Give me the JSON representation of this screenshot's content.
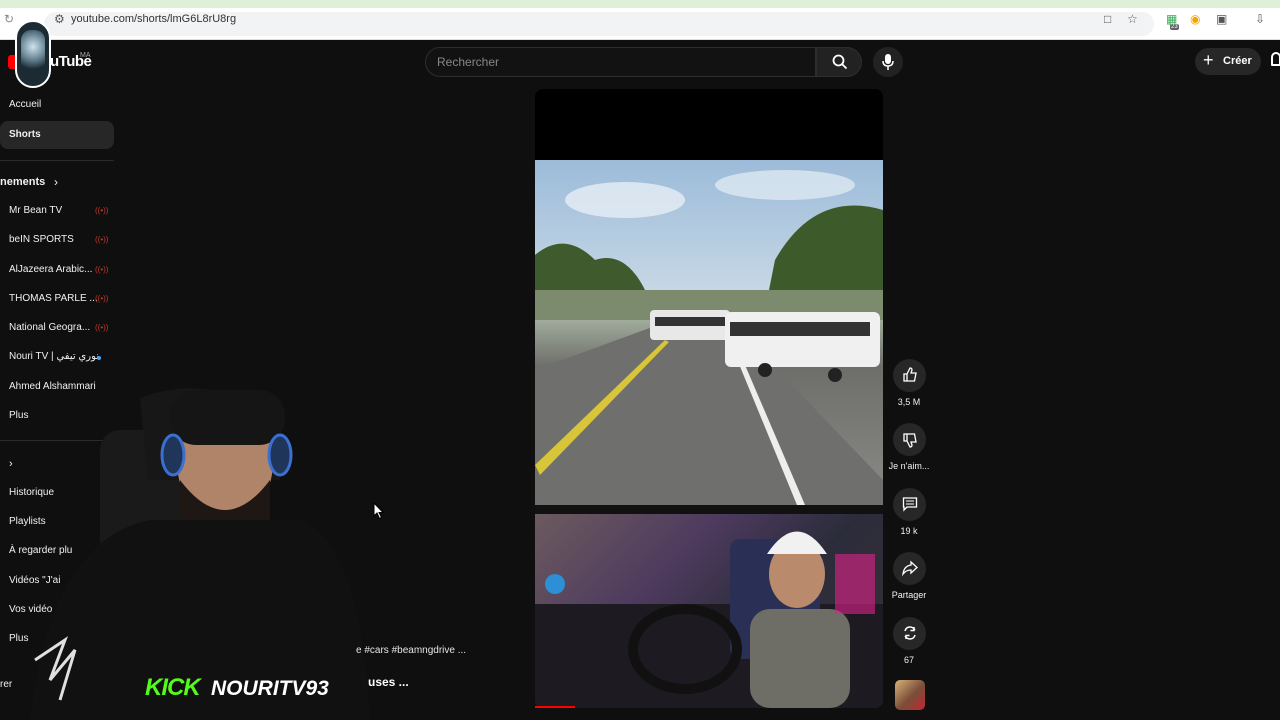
{
  "browser": {
    "url": "youtube.com/shorts/lmG6L8rU8rg",
    "extension_badge": "23"
  },
  "header": {
    "logo_text": "uTube",
    "country_code": "MA",
    "search_placeholder": "Rechercher",
    "create_label": "Créer"
  },
  "sidebar": {
    "home": "Accueil",
    "shorts": "Shorts",
    "subscriptions_heading": "nements",
    "subscriptions": [
      {
        "label": "Mr Bean TV",
        "indicator": "live"
      },
      {
        "label": "beIN SPORTS",
        "indicator": "live"
      },
      {
        "label": "AlJazeera Arabic...",
        "indicator": "live"
      },
      {
        "label": "THOMAS PARLE ...",
        "indicator": "live"
      },
      {
        "label": "National Geogra...",
        "indicator": "live"
      },
      {
        "label": "Nouri TV | نوري تيفي",
        "indicator": "new"
      },
      {
        "label": "Ahmed Alshammari",
        "indicator": ""
      }
    ],
    "more_label": "Plus",
    "you_items": [
      "Historique",
      "Playlists",
      "À regarder plu",
      "Vidéos \"J'ai",
      "Vos vidéo",
      "Plus"
    ],
    "explore_fragment": "rer"
  },
  "short": {
    "hashtags": "e #cars #beamngdrive ...",
    "title_fragment": "uses ..."
  },
  "actions": {
    "likes": "3,5 M",
    "dislike_label": "Je n'aim...",
    "comments": "19 k",
    "share_label": "Partager",
    "remix_count": "67"
  },
  "overlay": {
    "kick_label": "KICK",
    "kick_username": "NOURITV93"
  },
  "colors": {
    "background": "#0f0f0f",
    "kick_green": "#53fc18",
    "yt_red": "#ff0000",
    "live_red": "#c0392b",
    "chip": "#272727"
  }
}
